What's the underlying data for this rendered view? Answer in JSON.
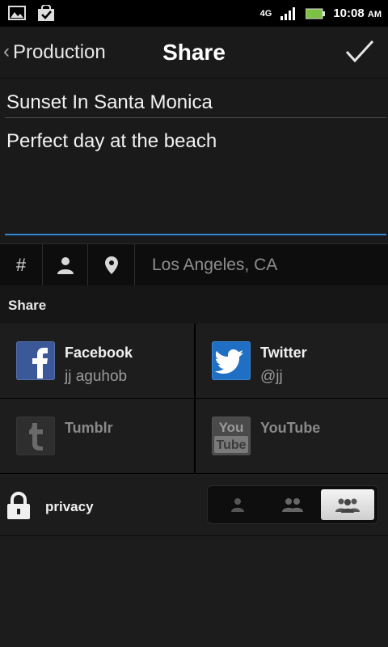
{
  "status_bar": {
    "network": "4G",
    "time": "10:08",
    "ampm": "AM"
  },
  "header": {
    "back_label": "Production",
    "title": "Share"
  },
  "form": {
    "title_value": "Sunset In Santa Monica",
    "description_value": "Perfect day at the beach"
  },
  "tag_bar": {
    "hashtag_symbol": "#",
    "location": "Los Angeles, CA"
  },
  "share": {
    "heading": "Share",
    "services": [
      {
        "name": "Facebook",
        "account": "jj aguhob",
        "icon": "facebook-icon",
        "color": "#3b5998",
        "enabled": true
      },
      {
        "name": "Twitter",
        "account": "@jj",
        "icon": "twitter-icon",
        "color": "#1f6fc5",
        "enabled": true
      },
      {
        "name": "Tumblr",
        "account": "",
        "icon": "tumblr-icon",
        "color": "#3a3a3a",
        "enabled": false
      },
      {
        "name": "YouTube",
        "account": "",
        "icon": "youtube-icon",
        "color": "#4a4a4a",
        "enabled": false
      }
    ]
  },
  "privacy": {
    "label": "privacy",
    "options": [
      "private",
      "friends",
      "public"
    ],
    "selected": "public"
  },
  "colors": {
    "accent_blue": "#2f87d4",
    "background": "#1c1c1c"
  }
}
